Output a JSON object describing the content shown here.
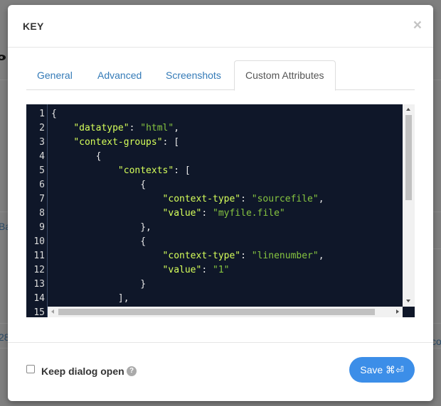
{
  "background": {
    "fragments": [
      "Ba",
      "28",
      "co"
    ]
  },
  "modal": {
    "title": "KEY",
    "close_glyph": "×"
  },
  "tabs": [
    {
      "label": "General",
      "active": false
    },
    {
      "label": "Advanced",
      "active": false
    },
    {
      "label": "Screenshots",
      "active": false
    },
    {
      "label": "Custom Attributes",
      "active": true
    }
  ],
  "editor": {
    "line_numbers": [
      "1",
      "2",
      "3",
      "4",
      "5",
      "6",
      "7",
      "8",
      "9",
      "10",
      "11",
      "12",
      "13",
      "14",
      "15"
    ],
    "lines": [
      [
        {
          "t": "p",
          "v": "{"
        }
      ],
      [
        {
          "t": "p",
          "v": "    "
        },
        {
          "t": "k",
          "v": "\"datatype\""
        },
        {
          "t": "p",
          "v": ": "
        },
        {
          "t": "s",
          "v": "\"html\""
        },
        {
          "t": "p",
          "v": ","
        }
      ],
      [
        {
          "t": "p",
          "v": "    "
        },
        {
          "t": "k",
          "v": "\"context-groups\""
        },
        {
          "t": "p",
          "v": ": ["
        }
      ],
      [
        {
          "t": "p",
          "v": "        {"
        }
      ],
      [
        {
          "t": "p",
          "v": "            "
        },
        {
          "t": "k",
          "v": "\"contexts\""
        },
        {
          "t": "p",
          "v": ": ["
        }
      ],
      [
        {
          "t": "p",
          "v": "                {"
        }
      ],
      [
        {
          "t": "p",
          "v": "                    "
        },
        {
          "t": "k",
          "v": "\"context-type\""
        },
        {
          "t": "p",
          "v": ": "
        },
        {
          "t": "s",
          "v": "\"sourcefile\""
        },
        {
          "t": "p",
          "v": ","
        }
      ],
      [
        {
          "t": "p",
          "v": "                    "
        },
        {
          "t": "k",
          "v": "\"value\""
        },
        {
          "t": "p",
          "v": ": "
        },
        {
          "t": "s",
          "v": "\"myfile.file\""
        }
      ],
      [
        {
          "t": "p",
          "v": "                },"
        }
      ],
      [
        {
          "t": "p",
          "v": "                {"
        }
      ],
      [
        {
          "t": "p",
          "v": "                    "
        },
        {
          "t": "k",
          "v": "\"context-type\""
        },
        {
          "t": "p",
          "v": ": "
        },
        {
          "t": "s",
          "v": "\"linenumber\""
        },
        {
          "t": "p",
          "v": ","
        }
      ],
      [
        {
          "t": "p",
          "v": "                    "
        },
        {
          "t": "k",
          "v": "\"value\""
        },
        {
          "t": "p",
          "v": ": "
        },
        {
          "t": "s",
          "v": "\"1\""
        }
      ],
      [
        {
          "t": "p",
          "v": "                }"
        }
      ],
      [
        {
          "t": "p",
          "v": "            ],"
        }
      ]
    ],
    "colors": {
      "background": "#0f1729",
      "key": "#d6ff5a",
      "string": "#86c440",
      "punct": "#e8e8e8"
    }
  },
  "footer": {
    "keep_open_label": "Keep dialog open",
    "keep_open_checked": false,
    "help_glyph": "?",
    "save_label": "Save ⌘⏎"
  },
  "colors": {
    "accent": "#3c8ee8",
    "link": "#337ab7"
  }
}
